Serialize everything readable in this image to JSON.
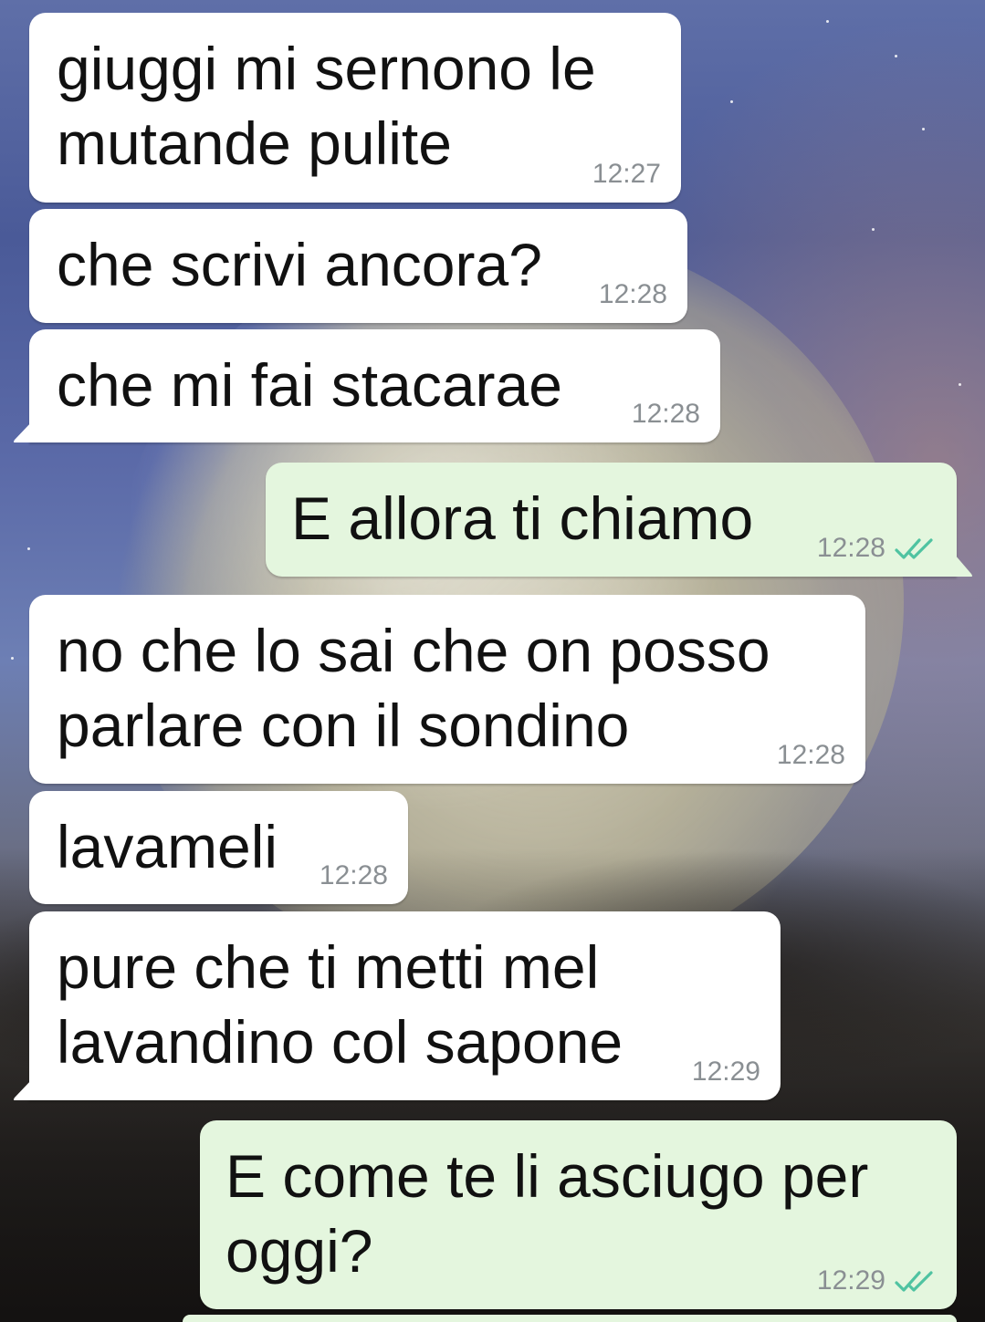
{
  "colors": {
    "incoming_bubble": "#ffffff",
    "outgoing_bubble": "#e4f6de",
    "timestamp": "#8a8f93",
    "read_ticks": "#4fc3a1"
  },
  "messages": [
    {
      "direction": "incoming",
      "text": "giuggi mi sernono le\nmutande pulite",
      "time": "12:27"
    },
    {
      "direction": "incoming",
      "text": "che scrivi ancora?",
      "time": "12:28"
    },
    {
      "direction": "incoming",
      "text": "che mi fai stacarae",
      "time": "12:28"
    },
    {
      "direction": "outgoing",
      "text": "E allora ti chiamo",
      "time": "12:28",
      "status_icon": "double-check-icon"
    },
    {
      "direction": "incoming",
      "text": "no che lo sai che on posso\nparlare con il sondino",
      "time": "12:28"
    },
    {
      "direction": "incoming",
      "text": "lavameli",
      "time": "12:28"
    },
    {
      "direction": "incoming",
      "text": "pure che ti metti mel\nlavandino col sapone",
      "time": "12:29"
    },
    {
      "direction": "outgoing",
      "text": "E come te li asciugo per\noggi?",
      "time": "12:29",
      "status_icon": "double-check-icon"
    }
  ]
}
